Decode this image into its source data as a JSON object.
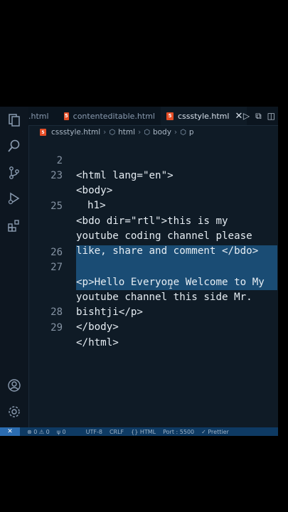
{
  "tabs": [
    {
      "label": ".html",
      "icon": "html5-icon"
    },
    {
      "label": "contenteditable.html",
      "icon": "html5-icon"
    },
    {
      "label": "cssstyle.html",
      "icon": "html5-icon",
      "active": true
    }
  ],
  "tab_close_glyph": "✕",
  "breadcrumb": [
    "cssstyle.html",
    "html",
    "body",
    "p"
  ],
  "editor": {
    "lines": [
      {
        "num": "2",
        "text": "<html lang=\"en\">"
      },
      {
        "num": "23",
        "text": "<body>"
      },
      {
        "num": "",
        "text": "h1>"
      },
      {
        "num": "25",
        "text": "<bdo dir=\"rtl\">this is my"
      },
      {
        "num": "",
        "text": "youtube coding channel please"
      },
      {
        "num": "",
        "text": "like, share and comment </bdo>"
      },
      {
        "num": "26",
        "text": ""
      },
      {
        "num": "27",
        "text": "<p>Hello Everyone Welcome to My"
      },
      {
        "num": "",
        "text": "youtube channel this side Mr."
      },
      {
        "num": "",
        "text": "bishtji</p>"
      },
      {
        "num": "28",
        "text": "</body>"
      },
      {
        "num": "29",
        "text": "</html>"
      }
    ]
  },
  "statusbar": {
    "remote": "✕",
    "problems": "⊗ 0 ⚠ 0",
    "ports": "ψ 0",
    "encoding": "UTF-8",
    "eol": "CRLF",
    "language": "{} HTML",
    "server": "Port : 5500",
    "prettier": "✓ Prettier"
  },
  "colors": {
    "background": "#0f1b26",
    "selection": "#1a4c74",
    "statusbar": "#0e3a63",
    "html5_badge": "#e44d26"
  }
}
